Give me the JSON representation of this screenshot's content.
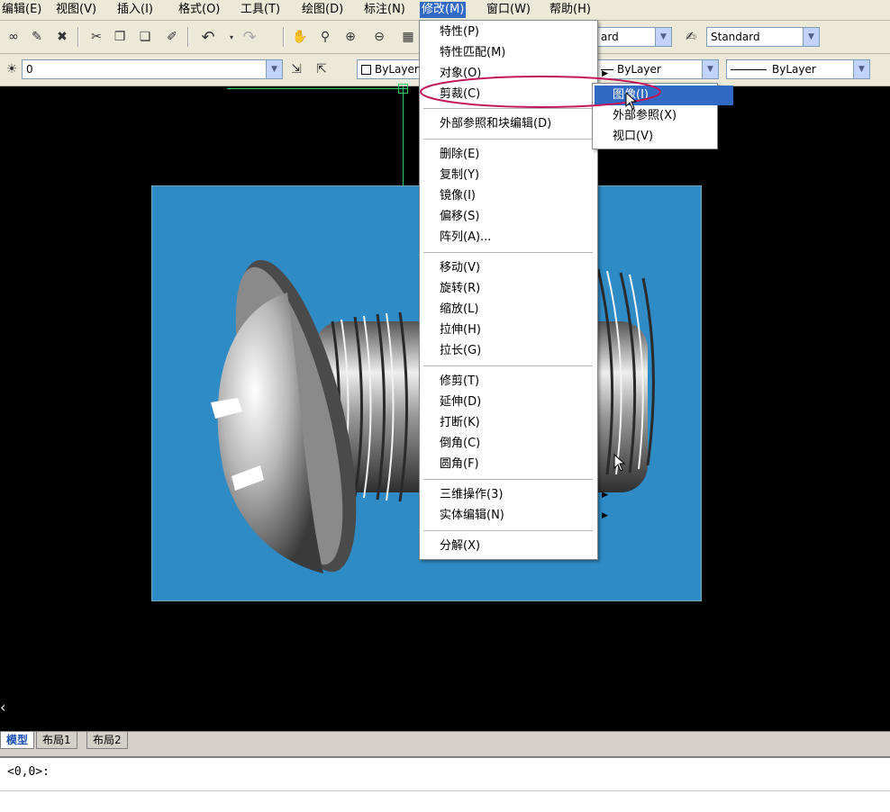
{
  "menubar": {
    "items": [
      {
        "label": "编辑(E)"
      },
      {
        "label": "视图(V)"
      },
      {
        "label": "插入(I)"
      },
      {
        "label": "格式(O)"
      },
      {
        "label": "工具(T)"
      },
      {
        "label": "绘图(D)"
      },
      {
        "label": "标注(N)"
      },
      {
        "label": "修改(M)"
      },
      {
        "label": "窗口(W)"
      },
      {
        "label": "帮助(H)"
      }
    ]
  },
  "toolbar": {
    "dimstyle_value": "ard",
    "textstyle_value": "Standard",
    "layer_value": "0",
    "color_value": "ByLayer",
    "linetype_value": "ByLayer",
    "lineweight_value": "ByLayer"
  },
  "modify_menu": {
    "items": [
      {
        "label": "特性(P)"
      },
      {
        "label": "特性匹配(M)"
      },
      {
        "label": "对象(O)"
      },
      {
        "label": "剪裁(C)"
      },
      {
        "label": "外部参照和块编辑(D)"
      },
      {
        "label": "删除(E)"
      },
      {
        "label": "复制(Y)"
      },
      {
        "label": "镜像(I)"
      },
      {
        "label": "偏移(S)"
      },
      {
        "label": "阵列(A)..."
      },
      {
        "label": "移动(V)"
      },
      {
        "label": "旋转(R)"
      },
      {
        "label": "缩放(L)"
      },
      {
        "label": "拉伸(H)"
      },
      {
        "label": "拉长(G)"
      },
      {
        "label": "修剪(T)"
      },
      {
        "label": "延伸(D)"
      },
      {
        "label": "打断(K)"
      },
      {
        "label": "倒角(C)"
      },
      {
        "label": "圆角(F)"
      },
      {
        "label": "三维操作(3)"
      },
      {
        "label": "实体编辑(N)"
      },
      {
        "label": "分解(X)"
      }
    ]
  },
  "clip_submenu": {
    "items": [
      {
        "label": "图像(I)"
      },
      {
        "label": "外部参照(X)"
      },
      {
        "label": "视口(V)"
      }
    ]
  },
  "tabs": [
    {
      "label": "模型"
    },
    {
      "label": "布局1"
    },
    {
      "label": "布局2"
    }
  ],
  "command_line": {
    "text": "<0,0>:"
  },
  "colors": {
    "viewport_bg": "#2e8bc6",
    "highlight": "#316ac5",
    "annotation_ellipse": "#c0185a"
  }
}
